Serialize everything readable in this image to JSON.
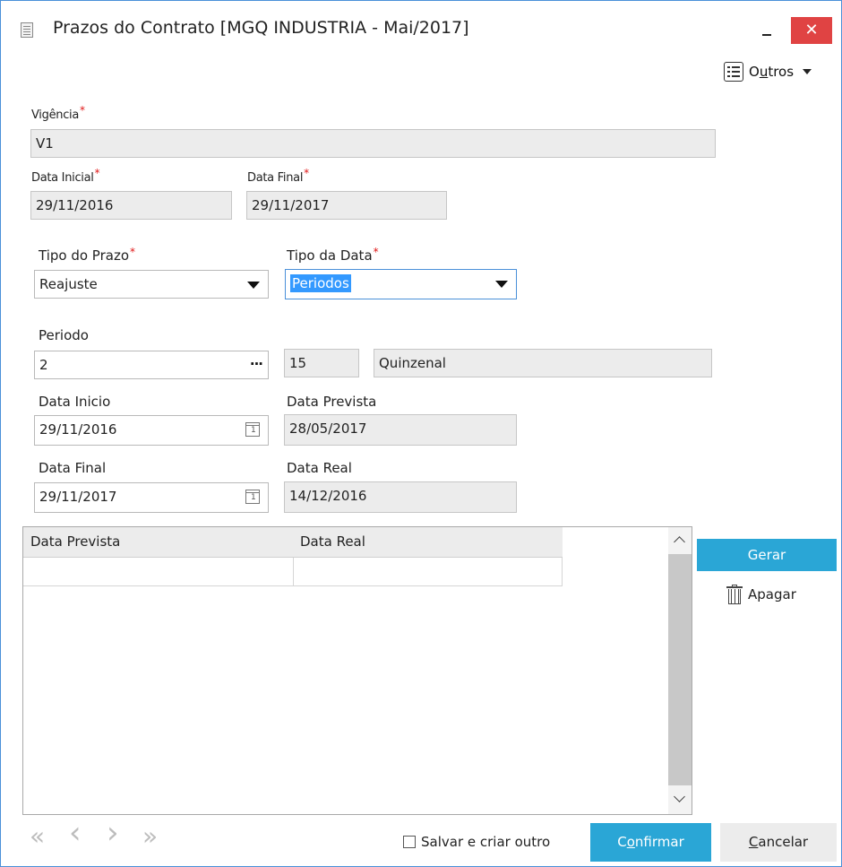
{
  "window": {
    "title": "Prazos do Contrato [MGQ INDUSTRIA - Mai/2017]",
    "close_glyph": "✕"
  },
  "toolbar": {
    "outros_prefix": "O",
    "outros_underlined": "u",
    "outros_suffix": "tros"
  },
  "form": {
    "vigencia": {
      "label": "Vigência",
      "value": "V1"
    },
    "data_inicial": {
      "label": "Data Inicial",
      "value": "29/11/2016"
    },
    "data_final_contrato": {
      "label": "Data Final",
      "value": "29/11/2017"
    },
    "tipo_prazo": {
      "label": "Tipo do Prazo",
      "value": "Reajuste"
    },
    "tipo_data": {
      "label": "Tipo da Data",
      "value": "Periodos"
    },
    "periodo": {
      "label": "Periodo",
      "value": "2",
      "ellipsis": "···",
      "days": "15",
      "description": "Quinzenal"
    },
    "data_inicio": {
      "label": "Data Inicio",
      "value": "29/11/2016"
    },
    "data_prevista": {
      "label": "Data Prevista",
      "value": "28/05/2017"
    },
    "data_final": {
      "label": "Data Final",
      "value": "29/11/2017"
    },
    "data_real": {
      "label": "Data Real",
      "value": "14/12/2016"
    },
    "required_mark": "*"
  },
  "grid": {
    "columns": [
      "Data Prevista",
      "Data Real"
    ],
    "rows": [
      [
        "",
        ""
      ]
    ]
  },
  "actions": {
    "gerar": "Gerar",
    "apagar": "Apagar"
  },
  "pager": {
    "first": "«",
    "prev": "‹",
    "next": "›",
    "last": "»"
  },
  "footer": {
    "salvar_criar_outro": "Salvar e criar outro",
    "confirmar_prefix": "C",
    "confirmar_underlined": "o",
    "confirmar_suffix": "nfirmar",
    "cancelar_underlined": "C",
    "cancelar_suffix": "ancelar"
  }
}
